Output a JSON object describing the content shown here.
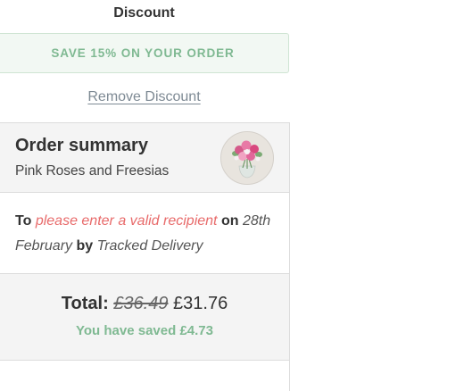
{
  "discount": {
    "title": "Discount",
    "promo_text": "SAVE 15% ON YOUR ORDER",
    "remove_label": "Remove Discount"
  },
  "summary": {
    "title": "Order summary",
    "product_name": "Pink Roses and Freesias",
    "thumbnail_icon": "flower-bouquet-icon"
  },
  "delivery": {
    "to_label": "To",
    "recipient_error": "please enter a valid recipient",
    "on_label": "on",
    "date": "28th February",
    "by_label": "by",
    "method": "Tracked Delivery"
  },
  "totals": {
    "label": "Total:",
    "original_price": "£36.49",
    "price": "£31.76",
    "saved_text": "You have saved £4.73"
  },
  "colors": {
    "accent_green": "#7fb992",
    "error_red": "#e86b6b",
    "link_grey": "#7e8a94"
  }
}
